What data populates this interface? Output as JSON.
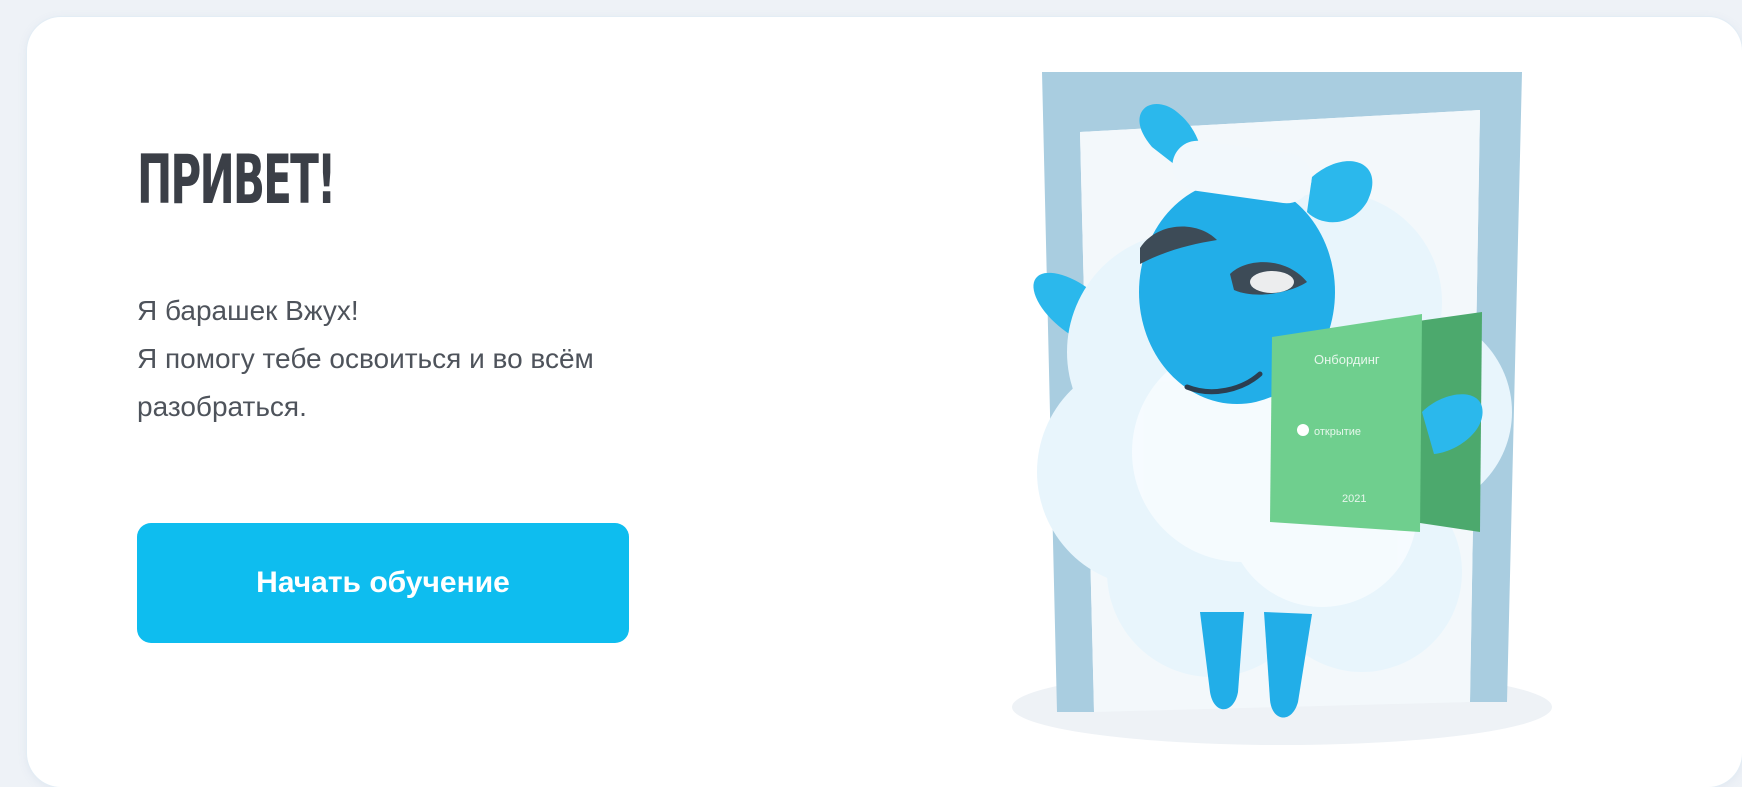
{
  "welcome": {
    "title": "ПРИВЕТ!",
    "description_lines": [
      "Я барашек Вжух!",
      "Я помогу тебе освоиться и во всём",
      "разобраться."
    ],
    "start_button_label": "Начать обучение"
  },
  "illustration": {
    "subject": "sheep-mascot",
    "book_title": "Онбординг",
    "book_brand": "открытие",
    "book_year": "2021"
  },
  "colors": {
    "accent": "#0ebdef",
    "title": "#3b3f47",
    "text": "#4e535b",
    "book": "#6fcf8e",
    "mascot_face": "#22aee8",
    "door_frame": "#a9cde0"
  }
}
